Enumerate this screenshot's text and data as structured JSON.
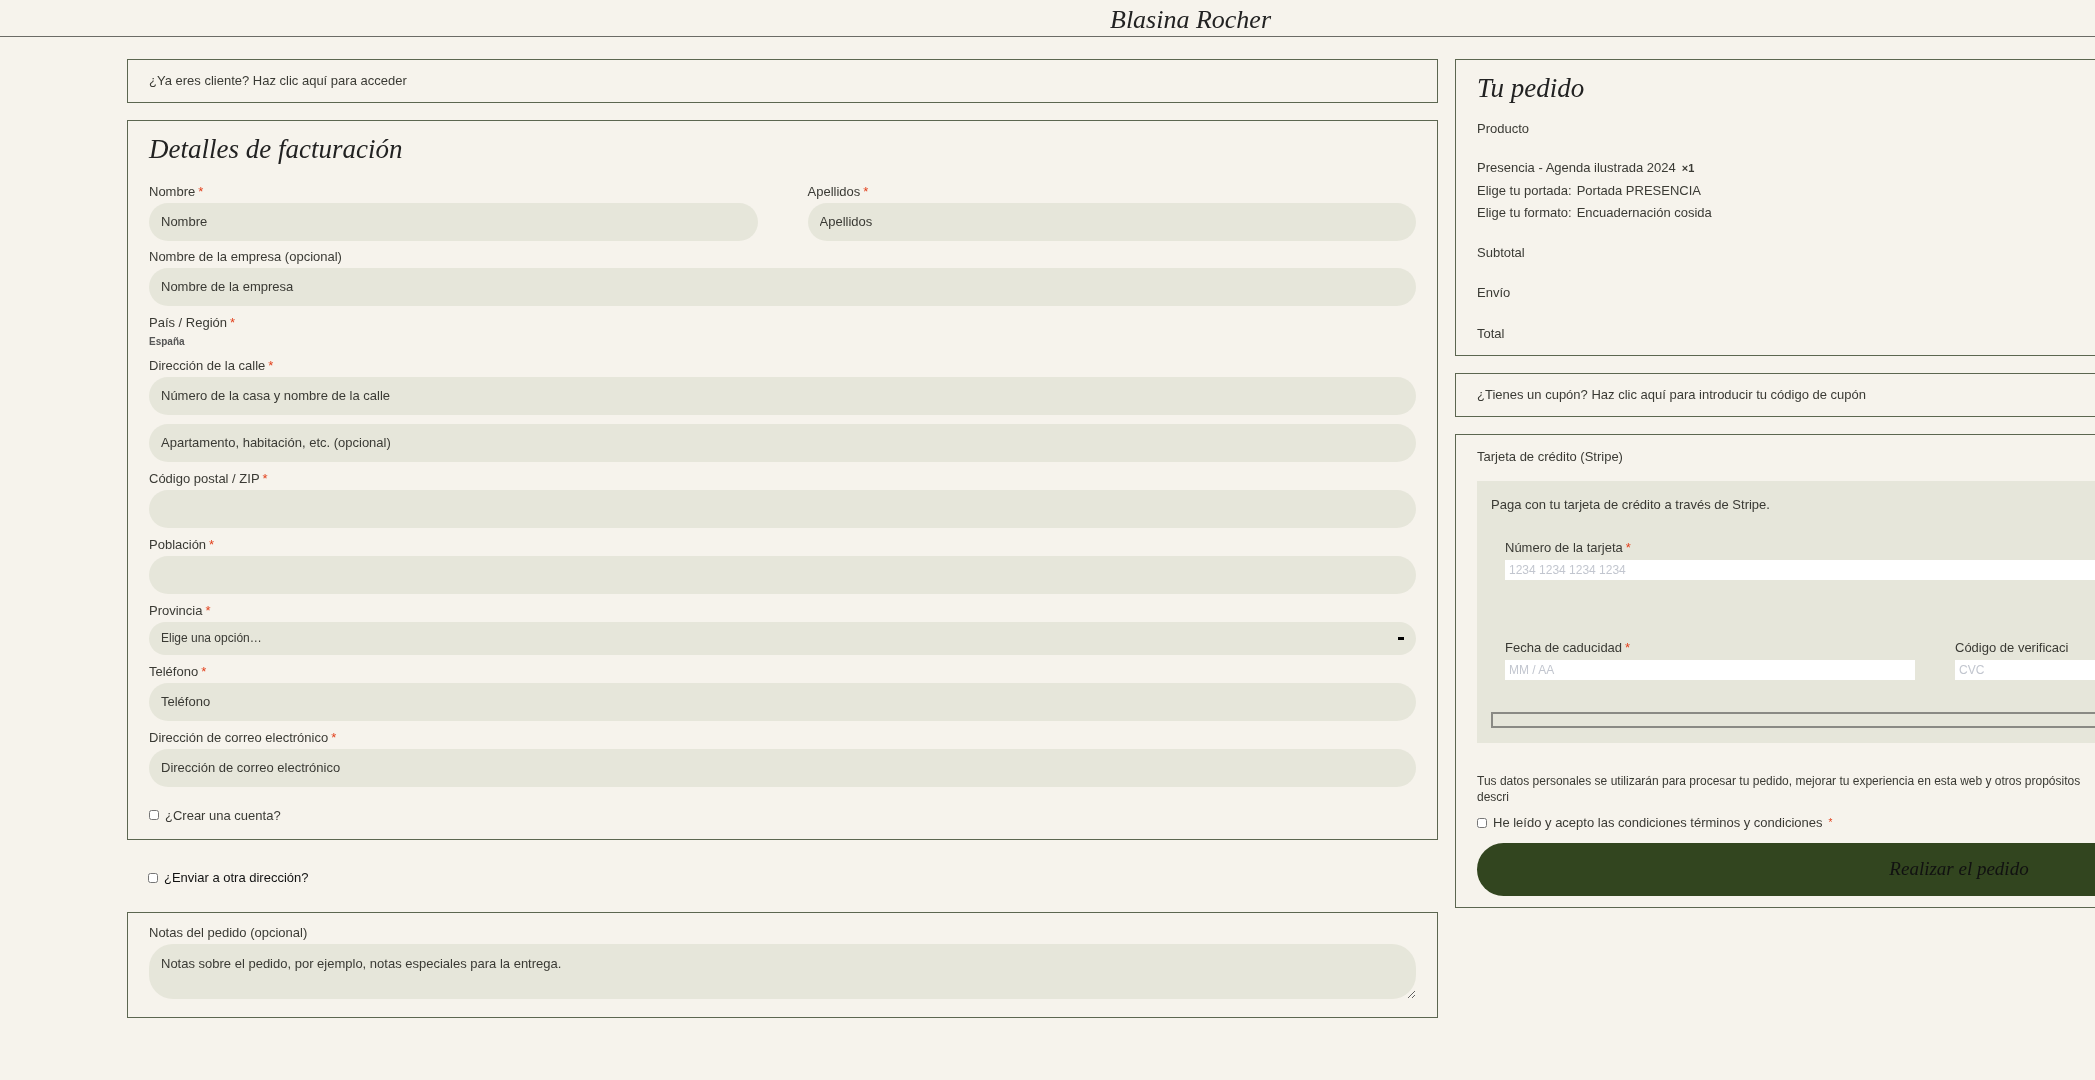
{
  "header": {
    "logo": "Blasina Rocher"
  },
  "required_mark": "*",
  "login_notice": "¿Ya eres cliente? Haz clic aquí para acceder",
  "billing": {
    "title": "Detalles de facturación",
    "fields": [
      {
        "kind": "pair",
        "columns": [
          {
            "label": "Nombre",
            "required": true,
            "placeholder": "Nombre"
          },
          {
            "label": "Apellidos",
            "required": true,
            "placeholder": "Apellidos"
          }
        ]
      },
      {
        "kind": "input",
        "label": "Nombre de la empresa (opcional)",
        "required": false,
        "placeholder": "Nombre de la empresa"
      },
      {
        "kind": "static",
        "label": "País / Región",
        "required": true,
        "value": "España"
      },
      {
        "kind": "input",
        "label": "Dirección de la calle",
        "required": true,
        "placeholder": "Número de la casa y nombre de la calle"
      },
      {
        "kind": "input",
        "placeholder": "Apartamento, habitación, etc. (opcional)"
      },
      {
        "kind": "input",
        "label": "Código postal / ZIP",
        "required": true
      },
      {
        "kind": "input",
        "label": "Población",
        "required": true
      },
      {
        "kind": "select",
        "label": "Provincia",
        "required": true,
        "value": "Elige una opción…"
      },
      {
        "kind": "input",
        "label": "Teléfono",
        "required": true,
        "placeholder": "Teléfono"
      },
      {
        "kind": "input",
        "label": "Dirección de correo electrónico",
        "required": true,
        "placeholder": "Dirección de correo electrónico"
      }
    ],
    "create_account": {
      "label": "¿Crear una cuenta?",
      "checked": false
    }
  },
  "ship_elsewhere": {
    "label": "¿Enviar a otra dirección?",
    "checked": false
  },
  "notes": {
    "label": "Notas del pedido (opcional)",
    "placeholder": "Notas sobre el pedido, por ejemplo, notas especiales para la entrega."
  },
  "order": {
    "title": "Tu pedido",
    "header": "Producto",
    "product": {
      "name": "Presencia - Agenda ilustrada 2024",
      "quantity": "×1",
      "meta": [
        {
          "key": "Elige tu portada:",
          "value": "Portada PRESENCIA"
        },
        {
          "key": "Elige tu formato:",
          "value": "Encuadernación cosida"
        }
      ]
    },
    "totals": [
      "Subtotal",
      "Envío",
      "Total"
    ]
  },
  "coupon_notice": "¿Tienes un cupón? Haz clic aquí para introducir tu código de cupón",
  "payment": {
    "method": "Tarjeta de crédito (Stripe)",
    "description": "Paga con tu tarjeta de crédito a través de Stripe.",
    "card_number": {
      "label": "Número de la tarjeta",
      "required": true,
      "placeholder": "1234 1234 1234 1234"
    },
    "expiry": {
      "label": "Fecha de caducidad",
      "required": true,
      "placeholder": "MM / AA"
    },
    "cvc": {
      "label": "Código de verificaci",
      "required": false,
      "placeholder": "CVC"
    }
  },
  "privacy": "Tus datos personales se utilizarán para procesar tu pedido, mejorar tu experiencia en esta web y otros propósitos descri",
  "terms": {
    "label": "He leído y acepto las condiciones términos y condiciones",
    "required": true,
    "checked": false
  },
  "place_order": "Realizar el pedido"
}
